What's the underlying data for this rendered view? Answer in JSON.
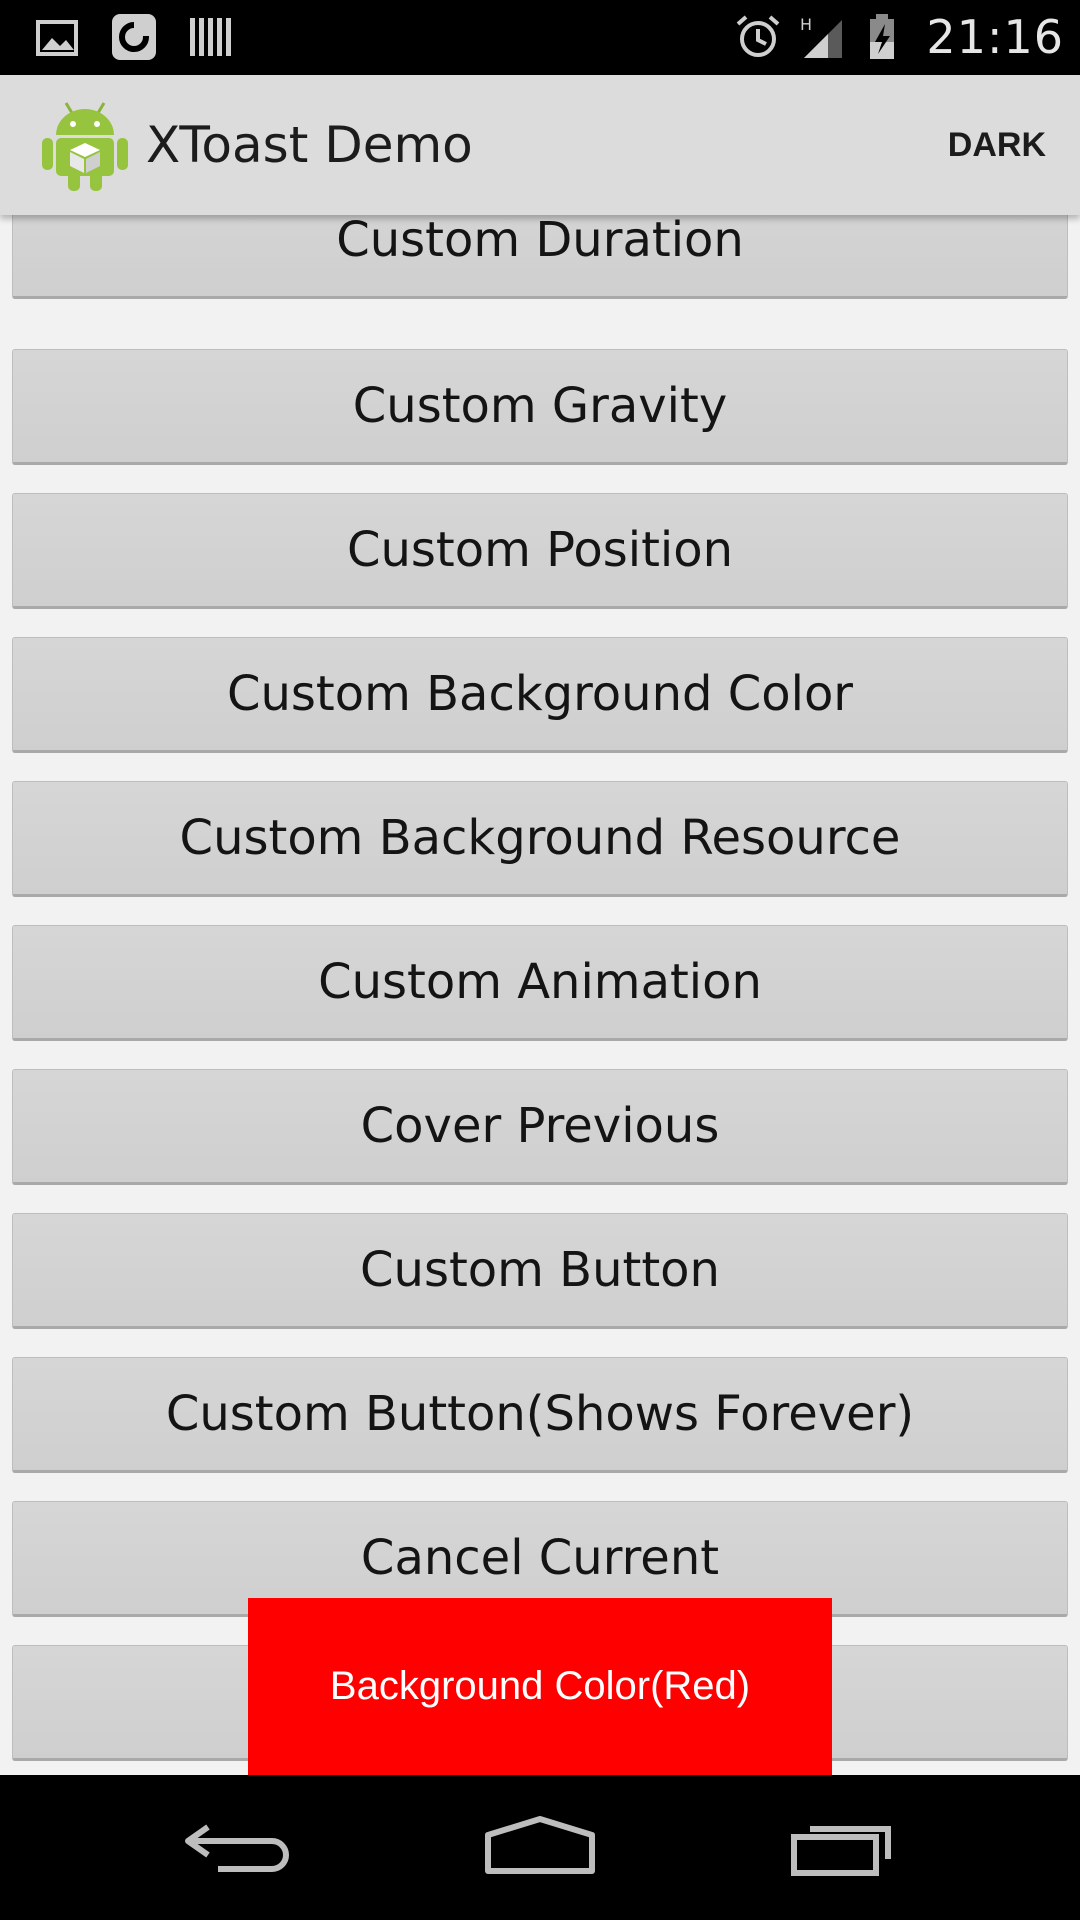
{
  "status_bar": {
    "time": "21:16",
    "left_icons": [
      "image-icon",
      "sync-icon",
      "barcode-icon"
    ],
    "right_icons": [
      "alarm-icon",
      "signal-icon",
      "battery-charging-icon"
    ],
    "network_type": "H"
  },
  "action_bar": {
    "title": "XToast Demo",
    "action_label": "DARK"
  },
  "buttons": [
    "Custom Duration",
    "Custom Gravity",
    "Custom Position",
    "Custom Background Color",
    "Custom Background Resource",
    "Custom Animation",
    "Cover Previous",
    "Custom Button",
    "Custom Button(Shows Forever)",
    "Cancel Current",
    ""
  ],
  "toast": {
    "text": "Background Color(Red)",
    "color": "#FE0000"
  },
  "nav_bar": {
    "icons": [
      "back-icon",
      "home-icon",
      "recents-icon"
    ]
  }
}
